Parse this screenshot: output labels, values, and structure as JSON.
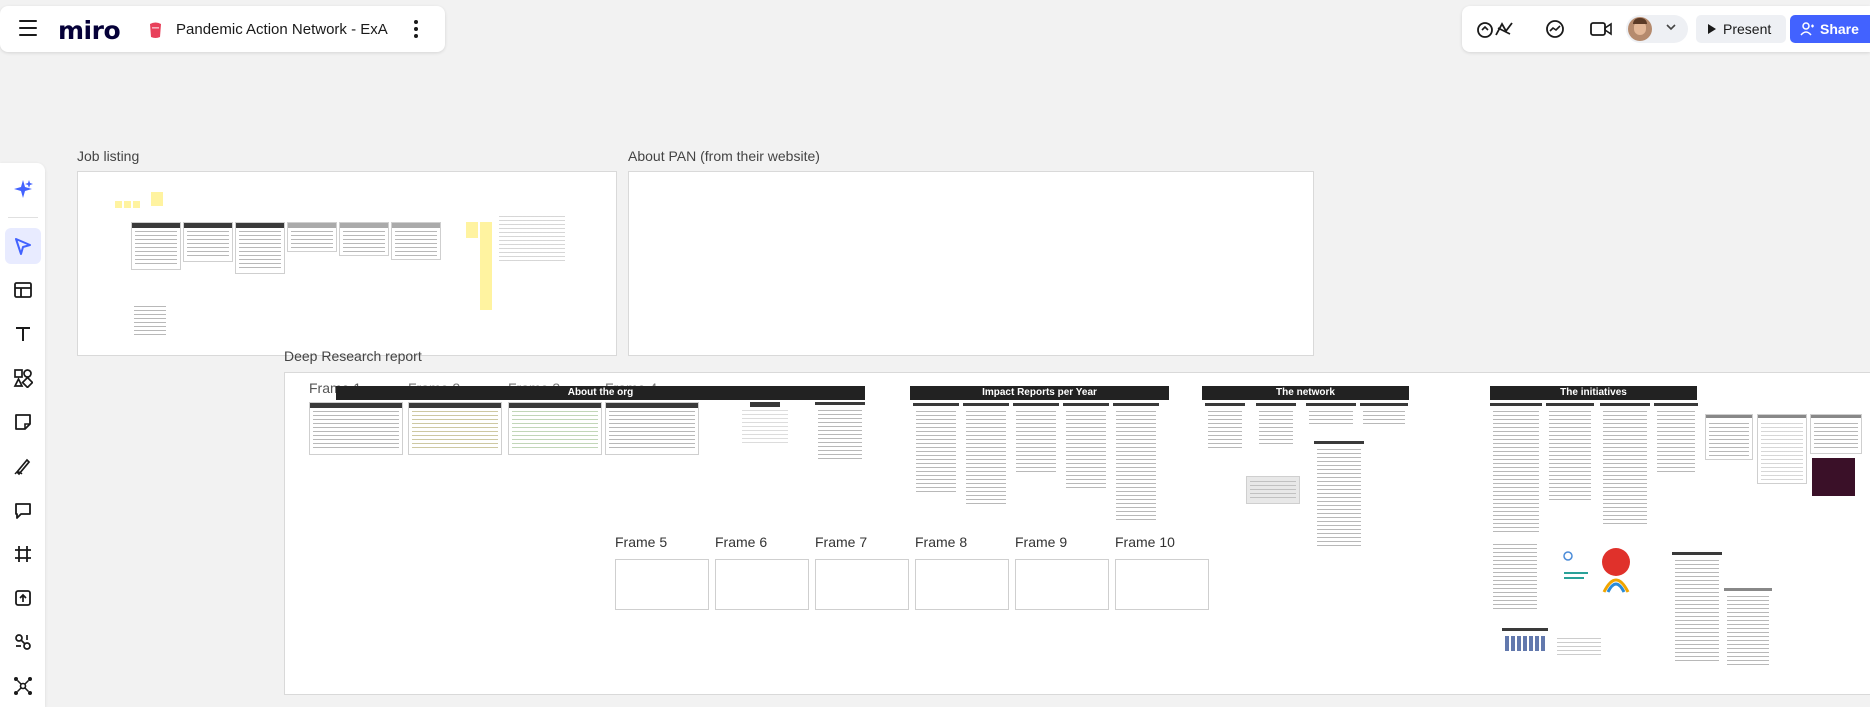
{
  "header": {
    "app_logo": "miro",
    "board_title": "Pandemic Action Network - ExA",
    "menu_icon": "hamburger-icon",
    "board_icon": "board-icon",
    "more_icon": "more-vertical-icon"
  },
  "top_right": {
    "reactions_icon": "reactions-icon",
    "chat_icon": "chat-icon",
    "video_icon": "video-icon",
    "present_label": "Present",
    "share_label": "Share",
    "accent_color": "#4262ff"
  },
  "toolbar": {
    "tools": [
      "ai-sparkle-icon",
      "select-icon",
      "templates-icon",
      "text-icon",
      "shapes-icon",
      "sticky-note-icon",
      "pen-icon",
      "comment-icon",
      "frame-icon",
      "upload-icon",
      "integrations-icon",
      "mindmap-icon"
    ]
  },
  "canvas": {
    "frames": {
      "job_listing": "Job listing",
      "about_pan": "About PAN (from their website)",
      "deep_research": "Deep Research report"
    },
    "sub_frames_top": [
      "Frame 1",
      "Frame 2",
      "Frame 3",
      "Frame 4"
    ],
    "sub_frames_bottom": [
      "Frame 5",
      "Frame 6",
      "Frame 7",
      "Frame 8",
      "Frame 9",
      "Frame 10"
    ],
    "sections": {
      "about_org": "About the org",
      "impact_reports": "Impact Reports per Year",
      "network": "The network",
      "initiatives": "The initiatives"
    }
  }
}
